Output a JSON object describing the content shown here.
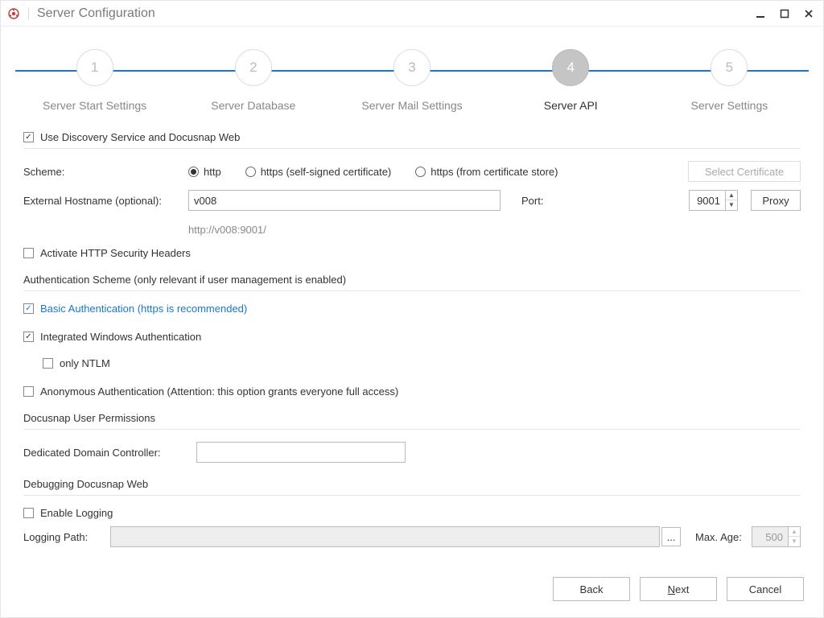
{
  "window": {
    "title": "Server Configuration"
  },
  "steps": [
    {
      "num": "1",
      "label": "Server Start Settings"
    },
    {
      "num": "2",
      "label": "Server Database"
    },
    {
      "num": "3",
      "label": "Server Mail Settings"
    },
    {
      "num": "4",
      "label": "Server API",
      "active": true
    },
    {
      "num": "5",
      "label": "Server Settings"
    }
  ],
  "use_discovery": {
    "label": "Use Discovery Service and Docusnap Web",
    "checked": true
  },
  "scheme": {
    "label": "Scheme:",
    "options": {
      "http": "http",
      "https_self": "https (self-signed certificate)",
      "https_store": "https (from certificate store)"
    },
    "selected": "http"
  },
  "select_cert": "Select Certificate",
  "hostname": {
    "label": "External Hostname (optional):",
    "value": "v008"
  },
  "port": {
    "label": "Port:",
    "value": "9001"
  },
  "proxy_btn": "Proxy",
  "url_preview": "http://v008:9001/",
  "sec_headers": {
    "label": "Activate HTTP Security Headers",
    "checked": false
  },
  "auth_header": "Authentication Scheme (only relevant if user management is enabled)",
  "auth_basic": {
    "label": "Basic Authentication (https is recommended)",
    "checked": true
  },
  "auth_iwa": {
    "label": "Integrated Windows Authentication",
    "checked": true
  },
  "auth_ntlm": {
    "label": "only NTLM",
    "checked": false
  },
  "auth_anon": {
    "label": "Anonymous Authentication (Attention: this option grants everyone full access)",
    "checked": false
  },
  "perm_header": "Docusnap User Permissions",
  "dedicated_dc": {
    "label": "Dedicated Domain Controller:",
    "value": ""
  },
  "debug_header": "Debugging Docusnap Web",
  "enable_logging": {
    "label": "Enable Logging",
    "checked": false
  },
  "logging_path": {
    "label": "Logging Path:",
    "value": ""
  },
  "max_age": {
    "label": "Max. Age:",
    "value": "500"
  },
  "browse_btn": "...",
  "footer": {
    "back": "Back",
    "next": "Next",
    "next_accel": "N",
    "cancel": "Cancel"
  }
}
